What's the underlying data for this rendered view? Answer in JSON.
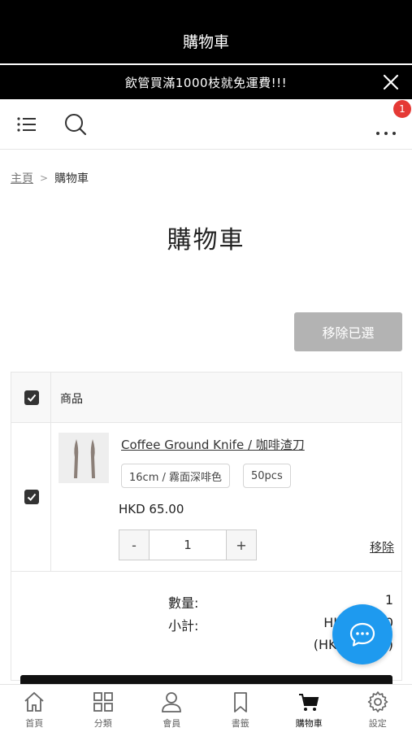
{
  "header": {
    "title": "購物車"
  },
  "promo": {
    "text": "飲管買滿1000枝就免運費!!!"
  },
  "toolbar": {
    "more_badge": "1"
  },
  "breadcrumb": {
    "home": "主頁",
    "separator": ">",
    "current": "購物車"
  },
  "page": {
    "title": "購物車",
    "remove_selected_label": "移除已選"
  },
  "table": {
    "header_label": "商品",
    "items": [
      {
        "name": "Coffee Ground Knife / 咖啡渣刀",
        "variants": [
          "16cm / 霧面深啡色",
          "50pcs"
        ],
        "price": "HKD 65.00",
        "qty_minus": "-",
        "quantity": "1",
        "qty_plus": "+",
        "remove_label": "移除",
        "selected": true
      }
    ]
  },
  "summary": {
    "qty_label": "數量:",
    "qty_value": "1",
    "subtotal_label": "小計:",
    "subtotal_value": "HKD 65.00",
    "subtotal_alt": "(HKD 65.00)"
  },
  "bottom_nav": [
    {
      "label": "首頁",
      "icon": "home-icon"
    },
    {
      "label": "分類",
      "icon": "grid-icon"
    },
    {
      "label": "會員",
      "icon": "user-icon"
    },
    {
      "label": "書籤",
      "icon": "bookmark-icon"
    },
    {
      "label": "購物車",
      "icon": "cart-icon",
      "active": true
    },
    {
      "label": "設定",
      "icon": "gear-icon"
    }
  ],
  "colors": {
    "accent": "#1e9aef",
    "badge": "#e53935",
    "disabled_button": "#b3b3b3"
  }
}
